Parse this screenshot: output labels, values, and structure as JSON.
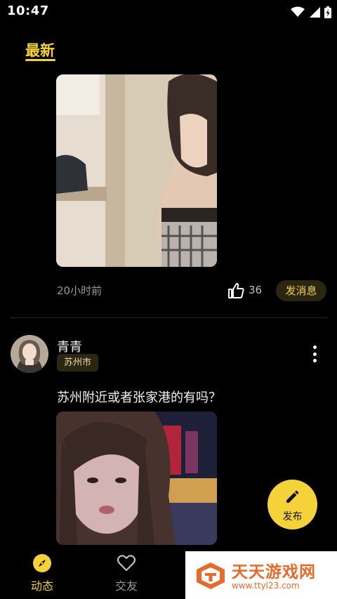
{
  "status_bar": {
    "time": "10:47",
    "icons": [
      "wifi-icon",
      "signal-icon",
      "battery-icon"
    ]
  },
  "tabs": {
    "active_label": "最新"
  },
  "post1": {
    "time_ago": "20小时前",
    "like_count": "36",
    "message_button": "发消息"
  },
  "post2": {
    "user_name": "青青",
    "city": "苏州市",
    "text": "苏州附近或者张家港的有吗？"
  },
  "fab": {
    "label": "发布",
    "icon": "pencil-icon"
  },
  "bottom_nav": {
    "items": [
      {
        "label": "动态",
        "icon": "compass-icon",
        "active": true
      },
      {
        "label": "交友",
        "icon": "heart-icon",
        "active": false
      }
    ]
  },
  "watermark": {
    "title": "天天游戏网",
    "url": "www.ttyl23.com"
  },
  "colors": {
    "accent": "#f5d23a",
    "background": "#000000",
    "badge_bg": "#2a2612",
    "muted_text": "#9a9a9a",
    "watermark": "#e86a2a"
  }
}
